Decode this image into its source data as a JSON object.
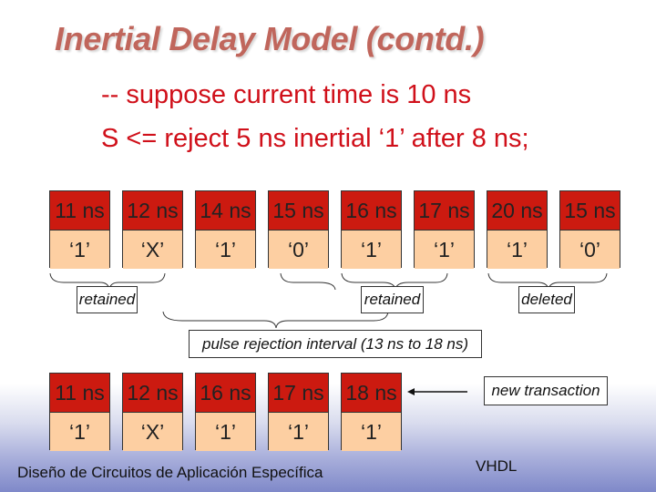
{
  "slide": {
    "title": "Inertial Delay Model (contd.)",
    "lines": [
      "-- suppose current time is 10 ns",
      "S <= reject 5 ns inertial ‘1’ after 8 ns;"
    ]
  },
  "queue_before": [
    {
      "time": "11 ns",
      "value": "‘1’"
    },
    {
      "time": "12 ns",
      "value": "‘X’"
    },
    {
      "time": "14 ns",
      "value": "‘1’"
    },
    {
      "time": "15 ns",
      "value": "‘0’"
    },
    {
      "time": "16 ns",
      "value": "‘1’"
    },
    {
      "time": "17 ns",
      "value": "‘1’"
    },
    {
      "time": "20 ns",
      "value": "‘1’"
    },
    {
      "time": "15 ns",
      "value": "‘0’"
    }
  ],
  "annotations": {
    "retained_1": "retained",
    "retained_2": "retained",
    "deleted": "deleted",
    "pulse_rejection": "pulse rejection interval (13 ns to 18 ns)",
    "new_transaction": "new transaction"
  },
  "queue_after": [
    {
      "time": "11 ns",
      "value": "‘1’"
    },
    {
      "time": "12 ns",
      "value": "‘X’"
    },
    {
      "time": "16 ns",
      "value": "‘1’"
    },
    {
      "time": "17 ns",
      "value": "‘1’"
    },
    {
      "time": "18 ns",
      "value": "‘1’"
    }
  ],
  "footer": {
    "left": "Diseño de Circuitos de Aplicación Específica",
    "right": "VHDL"
  },
  "colors": {
    "title": "#c0665c",
    "code_text": "#d0101a",
    "time_cell": "#cc1a10",
    "value_cell": "#fdcfa2"
  }
}
